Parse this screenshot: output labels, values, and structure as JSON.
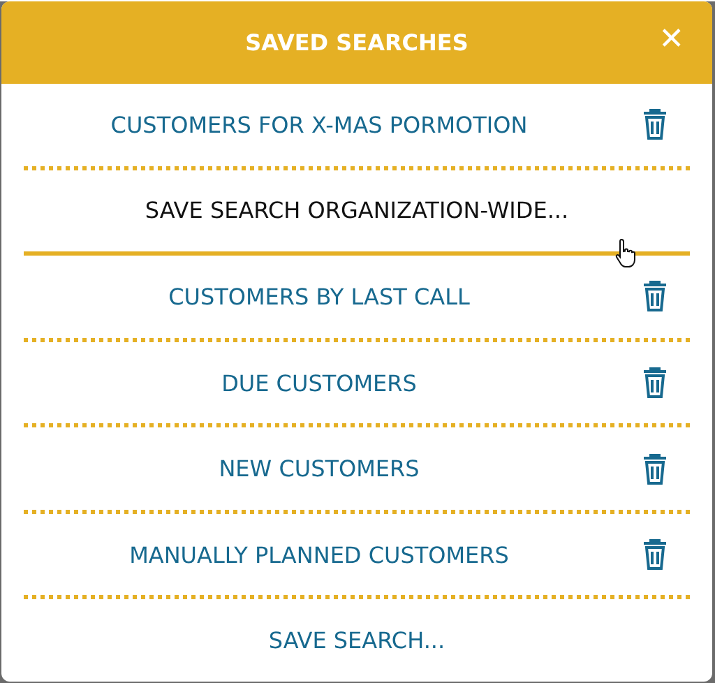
{
  "dialog": {
    "title": "SAVED SEARCHES",
    "close": "✕"
  },
  "items": [
    {
      "kind": "saved",
      "label": "CUSTOMERS FOR X-MAS PORMOTION",
      "hovered": false
    },
    {
      "kind": "action",
      "label": "SAVE SEARCH ORGANIZATION-WIDE...",
      "hovered": true
    },
    {
      "kind": "saved",
      "label": "CUSTOMERS BY LAST CALL",
      "hovered": false
    },
    {
      "kind": "saved",
      "label": "DUE CUSTOMERS",
      "hovered": false
    },
    {
      "kind": "saved",
      "label": "NEW CUSTOMERS",
      "hovered": false
    },
    {
      "kind": "saved",
      "label": "MANUALLY PLANNED CUSTOMERS",
      "hovered": false
    },
    {
      "kind": "action",
      "label": "SAVE SEARCH...",
      "hovered": false
    }
  ]
}
